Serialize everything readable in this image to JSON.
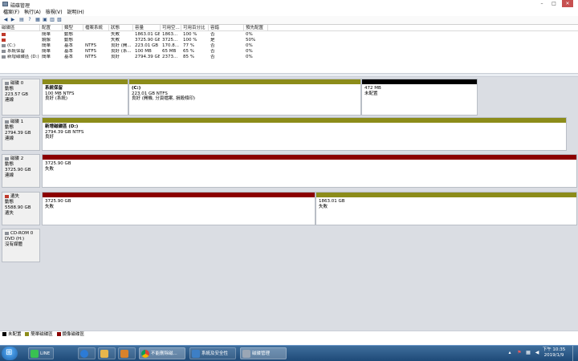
{
  "window": {
    "title": "磁碟管理"
  },
  "menu": [
    "檔案(F)",
    "執行(A)",
    "檢視(V)",
    "說明(H)"
  ],
  "columns": [
    "磁碟區",
    "配置",
    "類型",
    "檔案系統",
    "狀態",
    "容量",
    "可用空...",
    "可用百分比",
    "容錯",
    "預先配置"
  ],
  "volumes": [
    [
      "",
      "簡單",
      "動態",
      "",
      "失敗",
      "1863.01 GB",
      "1863...",
      "100 %",
      "否",
      "0%"
    ],
    [
      "",
      "鏡像",
      "動態",
      "",
      "失敗",
      "3725.90 GB",
      "3725...",
      "100 %",
      "是",
      "50%"
    ],
    [
      "(C:)",
      "簡單",
      "基本",
      "NTFS",
      "良好 (開...",
      "223.01 GB",
      "170.8...",
      "77 %",
      "否",
      "0%"
    ],
    [
      "系統保留",
      "簡單",
      "基本",
      "NTFS",
      "良好 (系...",
      "100 MB",
      "65 MB",
      "65 %",
      "否",
      "0%"
    ],
    [
      "新增磁碟區 (D:)",
      "簡單",
      "基本",
      "NTFS",
      "良好",
      "2794.39 GB",
      "2373...",
      "85 %",
      "否",
      "0%"
    ]
  ],
  "disks": [
    {
      "name": "磁碟 0",
      "type": "動態",
      "size": "223.57 GB",
      "status": "連線",
      "partitions": [
        {
          "name": "系統保留",
          "line1": "100 MB NTFS",
          "line2": "良好 (系統)",
          "color": "#8c8c1a"
        },
        {
          "name": "(C:)",
          "line1": "223.01 GB NTFS",
          "line2": "良好 (開機, 分頁檔案, 損毀傾印)",
          "color": "#8c8c1a"
        },
        {
          "name": "",
          "line1": "472 MB",
          "line2": "未配置",
          "color": "#000000"
        }
      ]
    },
    {
      "name": "磁碟 1",
      "type": "動態",
      "size": "2794.39 GB",
      "status": "連線",
      "partitions": [
        {
          "name": "新增磁碟區 (D:)",
          "line1": "2794.39 GB NTFS",
          "line2": "良好",
          "color": "#8c8c1a"
        }
      ]
    },
    {
      "name": "磁碟 2",
      "type": "動態",
      "size": "3725.90 GB",
      "status": "連線",
      "partitions": [
        {
          "name": "",
          "line1": "3725.90 GB",
          "line2": "失敗",
          "color": "#8b0000"
        }
      ]
    },
    {
      "name": "遺失",
      "type": "動態",
      "size": "5588.90 GB",
      "status": "遺失",
      "partitions": [
        {
          "name": "",
          "line1": "3725.90 GB",
          "line2": "失敗",
          "color": "#8b0000"
        },
        {
          "name": "",
          "line1": "1863.01 GB",
          "line2": "失敗",
          "color": "#8c8c1a"
        }
      ]
    },
    {
      "name": "CD-ROM 0",
      "type": "DVD (H:)",
      "size": "",
      "status": "沒有媒體",
      "partitions": []
    }
  ],
  "legend": [
    {
      "label": "未配置",
      "color": "#000000"
    },
    {
      "label": "簡單磁碟區",
      "color": "#8c8c1a"
    },
    {
      "label": "鏡像磁碟區",
      "color": "#8b0000"
    }
  ],
  "taskbar": {
    "buttons": [
      {
        "label": "LINE",
        "color": "#39c152"
      },
      {
        "label": "",
        "color": "#2c7bd6"
      },
      {
        "label": "",
        "color": "#e8b64c"
      },
      {
        "label": "",
        "color": "#d9822b"
      },
      {
        "label": "不能刪除磁...",
        "color": "#e0e0e0"
      },
      {
        "label": "系統及安全性",
        "color": "#3d7fc5"
      },
      {
        "label": "磁碟管理",
        "color": "#9aa6b5"
      }
    ],
    "clock_time": "下午 10:35",
    "clock_date": "2019/1/9"
  }
}
